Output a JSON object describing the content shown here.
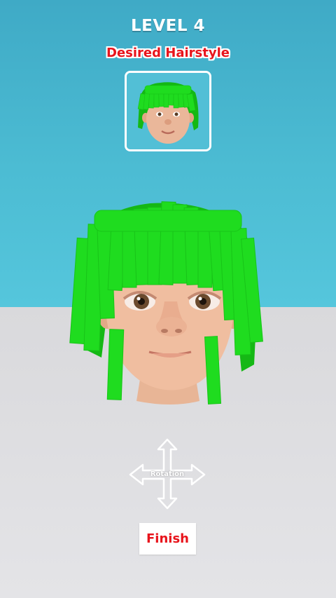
{
  "level": {
    "title": "LEVEL 4"
  },
  "target": {
    "label": "Desired Hairstyle"
  },
  "controls": {
    "rotation_label": "Rotation"
  },
  "actions": {
    "finish_label": "Finish"
  },
  "colors": {
    "sky": "#4cbcd3",
    "floor": "#e0e0e3",
    "hair": "#1fdc1f",
    "skin": "#f0bea0",
    "accent_red": "#e8141c"
  },
  "icons": {
    "rotation": "four-way-arrow-icon"
  }
}
